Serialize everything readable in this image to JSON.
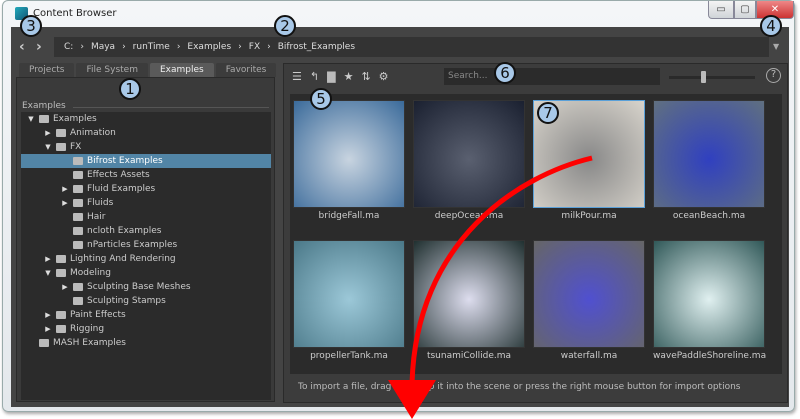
{
  "window": {
    "title": "Content Browser",
    "minimize": "▭",
    "maximize": "▢",
    "close": "✕"
  },
  "nav": {
    "back": "‹",
    "forward": "›"
  },
  "breadcrumb": [
    "C:",
    "Maya",
    "runTime",
    "Examples",
    "FX",
    "Bifrost_Examples"
  ],
  "breadcrumb_sep": "›",
  "tabs": [
    "Projects",
    "File System",
    "Examples",
    "Favorites"
  ],
  "tree": {
    "label": "Examples",
    "nodes": [
      {
        "label": "Examples",
        "level": 0,
        "arrow": "▼",
        "open": true
      },
      {
        "label": "Animation",
        "level": 1,
        "arrow": "▶"
      },
      {
        "label": "FX",
        "level": 1,
        "arrow": "▼",
        "open": true
      },
      {
        "label": "Bifrost Examples",
        "level": 2,
        "arrow": "",
        "selected": true,
        "open": true
      },
      {
        "label": "Effects Assets",
        "level": 2,
        "arrow": ""
      },
      {
        "label": "Fluid Examples",
        "level": 2,
        "arrow": "▶"
      },
      {
        "label": "Fluids",
        "level": 2,
        "arrow": "▶"
      },
      {
        "label": "Hair",
        "level": 2,
        "arrow": ""
      },
      {
        "label": "ncloth Examples",
        "level": 2,
        "arrow": ""
      },
      {
        "label": "nParticles Examples",
        "level": 2,
        "arrow": ""
      },
      {
        "label": "Lighting And Rendering",
        "level": 1,
        "arrow": "▶"
      },
      {
        "label": "Modeling",
        "level": 1,
        "arrow": "▼",
        "open": true
      },
      {
        "label": "Sculpting Base Meshes",
        "level": 2,
        "arrow": "▶"
      },
      {
        "label": "Sculpting Stamps",
        "level": 2,
        "arrow": ""
      },
      {
        "label": "Paint Effects",
        "level": 1,
        "arrow": "▶"
      },
      {
        "label": "Rigging",
        "level": 1,
        "arrow": "▶"
      },
      {
        "label": "MASH Examples",
        "level": 0,
        "arrow": ""
      }
    ]
  },
  "toolbar": {
    "icons": [
      "list-icon",
      "back-arrow-icon",
      "new-folder-icon",
      "star-icon",
      "sort-icon",
      "gear-icon"
    ],
    "glyphs": [
      "☰",
      "↰",
      "▇",
      "★",
      "⇅",
      "⚙"
    ],
    "search_placeholder": "Search...",
    "zoom_slider": 0.4,
    "help": "?"
  },
  "files": [
    {
      "name": "bridgeFall.ma",
      "colors": [
        "#c8d4e0",
        "#3a6a9a"
      ]
    },
    {
      "name": "deepOcean.ma",
      "colors": [
        "#5a6070",
        "#1a2030"
      ]
    },
    {
      "name": "milkPour.ma",
      "colors": [
        "#888",
        "#d8d4cc"
      ],
      "selected": true
    },
    {
      "name": "oceanBeach.ma",
      "colors": [
        "#3040c0",
        "#607080"
      ]
    },
    {
      "name": "propellerTank.ma",
      "colors": [
        "#9cc8d8",
        "#4a7888"
      ]
    },
    {
      "name": "tsunamiCollide.ma",
      "colors": [
        "#dde",
        "#203030"
      ]
    },
    {
      "name": "waterfall.ma",
      "colors": [
        "#5050d0",
        "#666"
      ]
    },
    {
      "name": "wavePaddleShoreline.ma",
      "colors": [
        "#e0f0f0",
        "#305858"
      ]
    }
  ],
  "status": "To import a file, drag and drop it into the scene or press the right mouse button for import options",
  "callouts": [
    "1",
    "2",
    "3",
    "4",
    "5",
    "6",
    "7"
  ],
  "colors": {
    "selection": "#5285a6",
    "callout": "#a8c8e8",
    "arrow": "#ff0000"
  }
}
